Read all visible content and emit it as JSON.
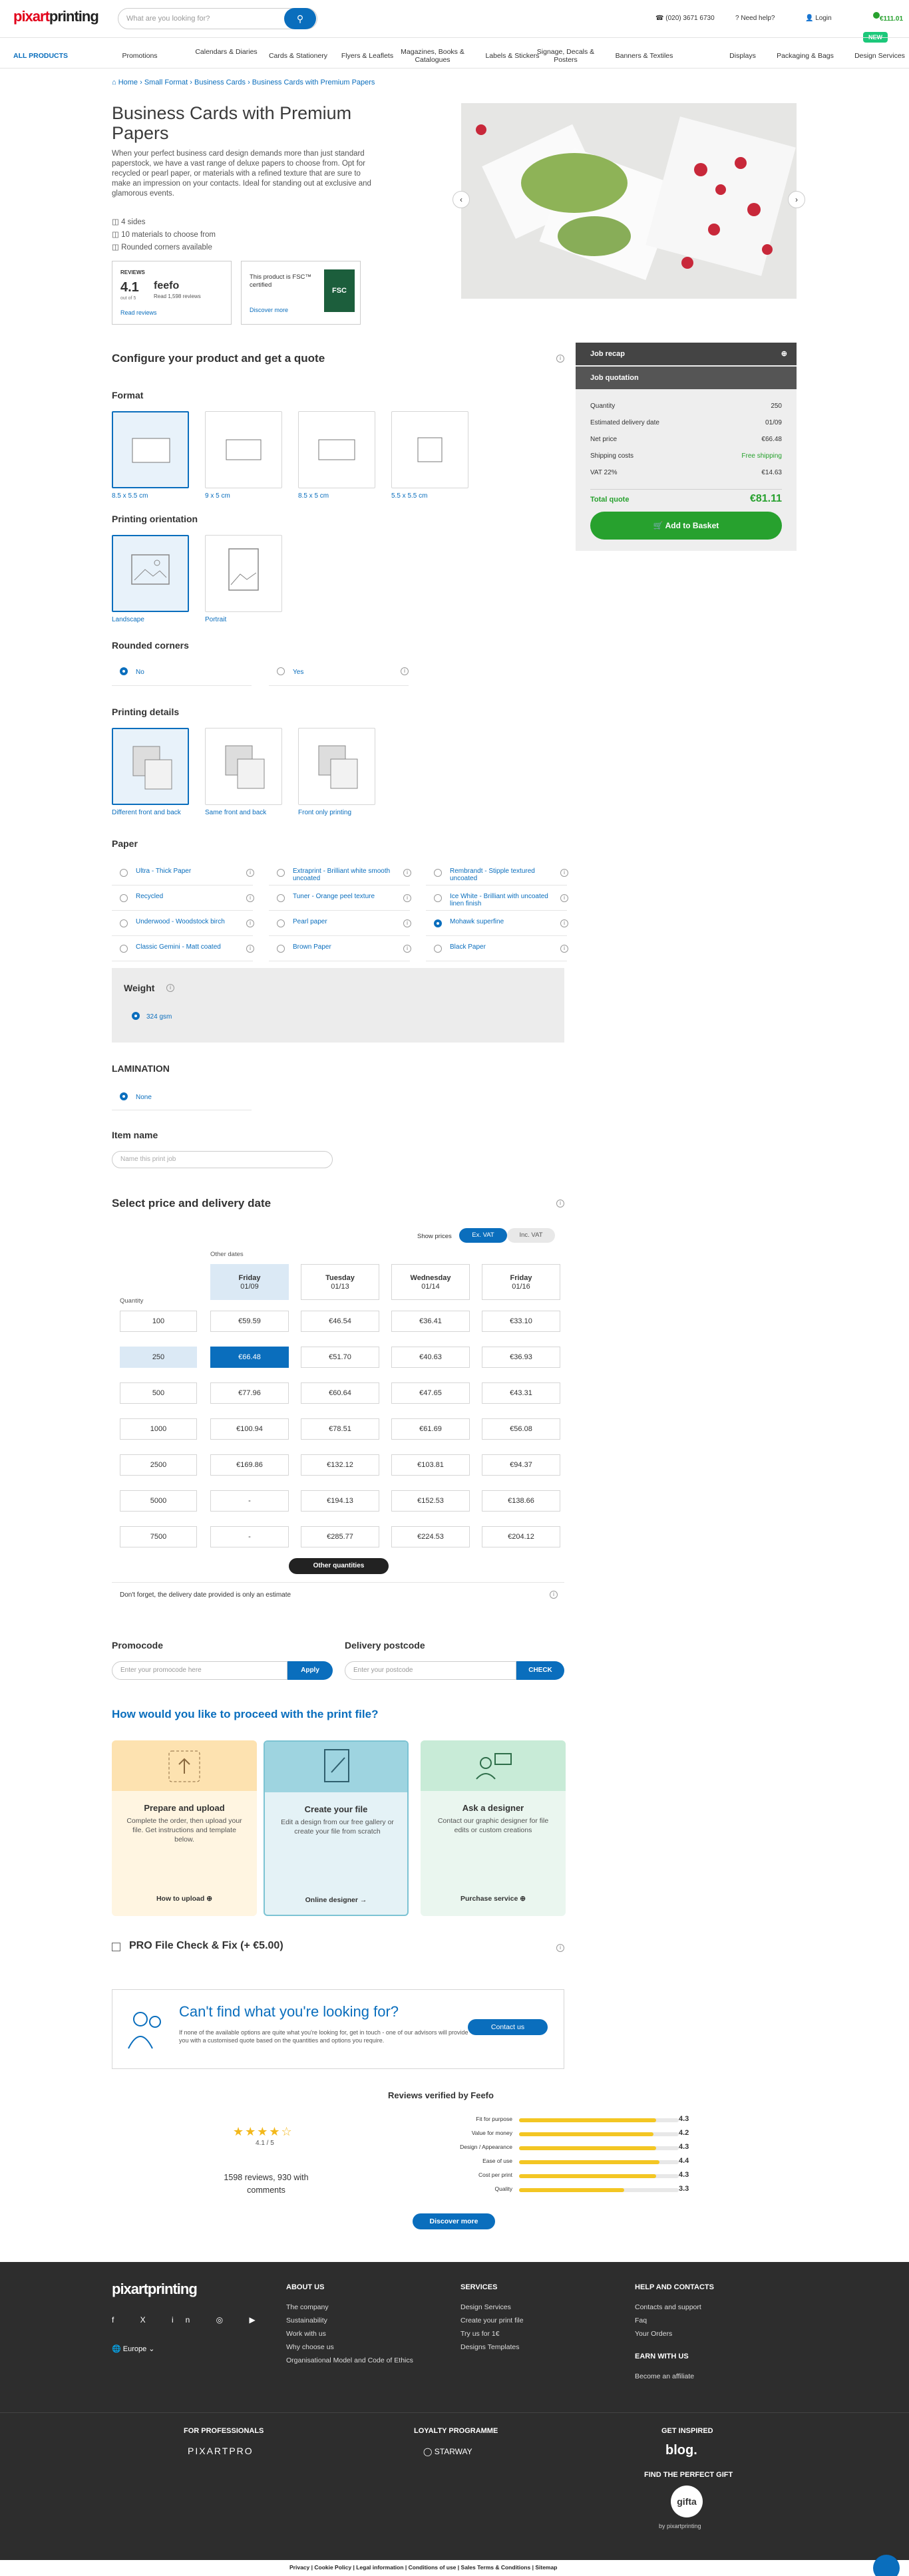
{
  "header": {
    "logo_a": "pixart",
    "logo_b": "printing",
    "search_placeholder": "What are you looking for?",
    "phone": "(020) 3671 6730",
    "help": "Need help?",
    "login": "Login",
    "cart": "€111.01",
    "new_badge": "NEW"
  },
  "nav": [
    "ALL PRODUCTS",
    "Promotions",
    "Calendars & Diaries",
    "Cards & Stationery",
    "Flyers & Leaflets",
    "Magazines, Books & Catalogues",
    "Labels & Stickers",
    "Signage, Decals & Posters",
    "Banners & Textiles",
    "Displays",
    "Packaging & Bags",
    "Design Services"
  ],
  "breadcrumb": [
    "Home",
    "Small Format",
    "Business Cards",
    "Business Cards with Premium Papers"
  ],
  "title": "Business Cards with Premium Papers",
  "intro": "When your perfect business card design demands more than just standard paperstock, we have a vast range of deluxe papers to choose from. Opt for recycled or pearl paper, or materials with a refined texture that are sure to make an impression on your contacts. Ideal for standing out at exclusive and glamorous events.",
  "features": [
    "4 sides",
    "10 materials to choose from",
    "Rounded corners available"
  ],
  "reviews": {
    "label": "REVIEWS",
    "score": "4.1",
    "scale": "out of 5",
    "brand": "feefo",
    "brand_sub": "Read 1,598 reviews",
    "link": "Read reviews"
  },
  "fsc": {
    "text": "This product is FSC™ certified",
    "link": "Discover more",
    "logo": "FSC"
  },
  "config_title": "Configure your product and get a quote",
  "format": {
    "title": "Format",
    "options": [
      "8.5 x 5.5 cm",
      "9 x 5 cm",
      "8.5 x 5 cm",
      "5.5 x 5.5 cm"
    ]
  },
  "orientation": {
    "title": "Printing orientation",
    "options": [
      "Landscape",
      "Portrait"
    ]
  },
  "corners": {
    "title": "Rounded corners",
    "options": [
      "No",
      "Yes"
    ]
  },
  "details": {
    "title": "Printing details",
    "options": [
      "Different front and back",
      "Same front and back",
      "Front only printing"
    ]
  },
  "paper": {
    "title": "Paper",
    "options": [
      "Ultra - Thick Paper",
      "Extraprint - Brilliant white smooth uncoated",
      "Rembrandt - Stipple textured uncoated",
      "Recycled",
      "Tuner - Orange peel texture",
      "Ice White - Brilliant with uncoated linen finish",
      "Underwood - Woodstock birch",
      "Pearl paper",
      "Mohawk superfine",
      "Classic Gemini - Matt coated",
      "Brown Paper",
      "Black Paper"
    ]
  },
  "weight": {
    "title": "Weight",
    "option": "324 gsm"
  },
  "lamination": {
    "title": "LAMINATION",
    "option": "None"
  },
  "item_name": {
    "title": "Item name",
    "placeholder": "Name this print job"
  },
  "price": {
    "title": "Select price and delivery date",
    "show_prices": "Show prices",
    "ex_vat": "Ex. VAT",
    "inc_vat": "Inc. VAT",
    "other_dates": "Other dates",
    "quantity": "Quantity",
    "days": [
      {
        "d": "Friday",
        "date": "01/09"
      },
      {
        "d": "Tuesday",
        "date": "01/13"
      },
      {
        "d": "Wednesday",
        "date": "01/14"
      },
      {
        "d": "Friday",
        "date": "01/16"
      }
    ],
    "rows": [
      {
        "q": "100",
        "p": [
          "€59.59",
          "€46.54",
          "€36.41",
          "€33.10"
        ]
      },
      {
        "q": "250",
        "p": [
          "€66.48",
          "€51.70",
          "€40.63",
          "€36.93"
        ]
      },
      {
        "q": "500",
        "p": [
          "€77.96",
          "€60.64",
          "€47.65",
          "€43.31"
        ]
      },
      {
        "q": "1000",
        "p": [
          "€100.94",
          "€78.51",
          "€61.69",
          "€56.08"
        ]
      },
      {
        "q": "2500",
        "p": [
          "€169.86",
          "€132.12",
          "€103.81",
          "€94.37"
        ]
      },
      {
        "q": "5000",
        "p": [
          "-",
          "€194.13",
          "€152.53",
          "€138.66"
        ]
      },
      {
        "q": "7500",
        "p": [
          "-",
          "€285.77",
          "€224.53",
          "€204.12"
        ]
      }
    ],
    "other_q": "Other quantities",
    "note": "Don't forget, the delivery date provided is only an estimate"
  },
  "promo": {
    "title": "Promocode",
    "placeholder": "Enter your promocode here",
    "btn": "Apply"
  },
  "postcode": {
    "title": "Delivery postcode",
    "placeholder": "Enter your postcode",
    "btn": "CHECK"
  },
  "file": {
    "title": "How would you like to proceed with the print file?",
    "cards": [
      {
        "t": "Prepare and upload",
        "d": "Complete the order, then upload your file. Get instructions and template below.",
        "l": "How to upload"
      },
      {
        "t": "Create your file",
        "d": "Edit a design from our free gallery or create your file from scratch",
        "l": "Online designer"
      },
      {
        "t": "Ask a designer",
        "d": "Contact our graphic designer for file edits or custom creations",
        "l": "Purchase service"
      }
    ]
  },
  "profile": "PRO File Check & Fix (+ €5.00)",
  "cant_find": {
    "title": "Can't find what you're looking for?",
    "text": "If none of the available options are quite what you're looking for, get in touch - one of our advisors will provide you with a customised quote based on the quantities and options you require.",
    "btn": "Contact us"
  },
  "feefo": {
    "title": "Reviews verified by Feefo",
    "score": "4.1 / 5",
    "count": "1598 reviews, 930 with comments",
    "btn": "Discover more",
    "bars": [
      {
        "l": "Fit for purpose",
        "v": "4.3",
        "pct": 86
      },
      {
        "l": "Value for money",
        "v": "4.2",
        "pct": 84
      },
      {
        "l": "Design / Appearance",
        "v": "4.3",
        "pct": 86
      },
      {
        "l": "Ease of use",
        "v": "4.4",
        "pct": 88
      },
      {
        "l": "Cost per print",
        "v": "4.3",
        "pct": 86
      },
      {
        "l": "Quality",
        "v": "3.3",
        "pct": 66
      }
    ]
  },
  "recap": {
    "title": "Job recap",
    "quote_title": "Job quotation",
    "rows": [
      {
        "l": "Quantity",
        "v": "250"
      },
      {
        "l": "Estimated delivery date",
        "v": "01/09"
      },
      {
        "l": "Net price",
        "v": "€66.48"
      },
      {
        "l": "Shipping costs",
        "v": "Free shipping"
      },
      {
        "l": "VAT 22%",
        "v": "€14.63"
      }
    ],
    "total_l": "Total quote",
    "total_v": "€81.11",
    "btn": "Add to Basket"
  },
  "footer": {
    "logo": "pixartprinting",
    "region": "Europe",
    "cols": [
      {
        "h": "ABOUT US",
        "items": [
          "The company",
          "Sustainability",
          "Work with us",
          "Why choose us",
          "Organisational Model and Code of Ethics"
        ]
      },
      {
        "h": "SERVICES",
        "items": [
          "Design Services",
          "Create your print file",
          "Try us for 1€",
          "Designs Templates"
        ]
      },
      {
        "h": "HELP AND CONTACTS",
        "items": [
          "Contacts and support",
          "Faq",
          "Your Orders"
        ],
        "h2": "EARN WITH US",
        "items2": [
          "Become an affiliate"
        ]
      }
    ],
    "pro_h": "FOR PROFESSIONALS",
    "pro": "PIXARTPRO",
    "loyalty_h": "LOYALTY PROGRAMME",
    "loyalty": "STARWAY",
    "insp_h": "GET INSPIRED",
    "blog": "blog.",
    "gift_h": "FIND THE PERFECT GIFT",
    "gift": "gifta",
    "gift_sub": "by pixartprinting",
    "legal": [
      "Privacy",
      "Cookie Policy",
      "Legal information",
      "Conditions of use",
      "Sales Terms & Conditions",
      "Sitemap"
    ]
  }
}
